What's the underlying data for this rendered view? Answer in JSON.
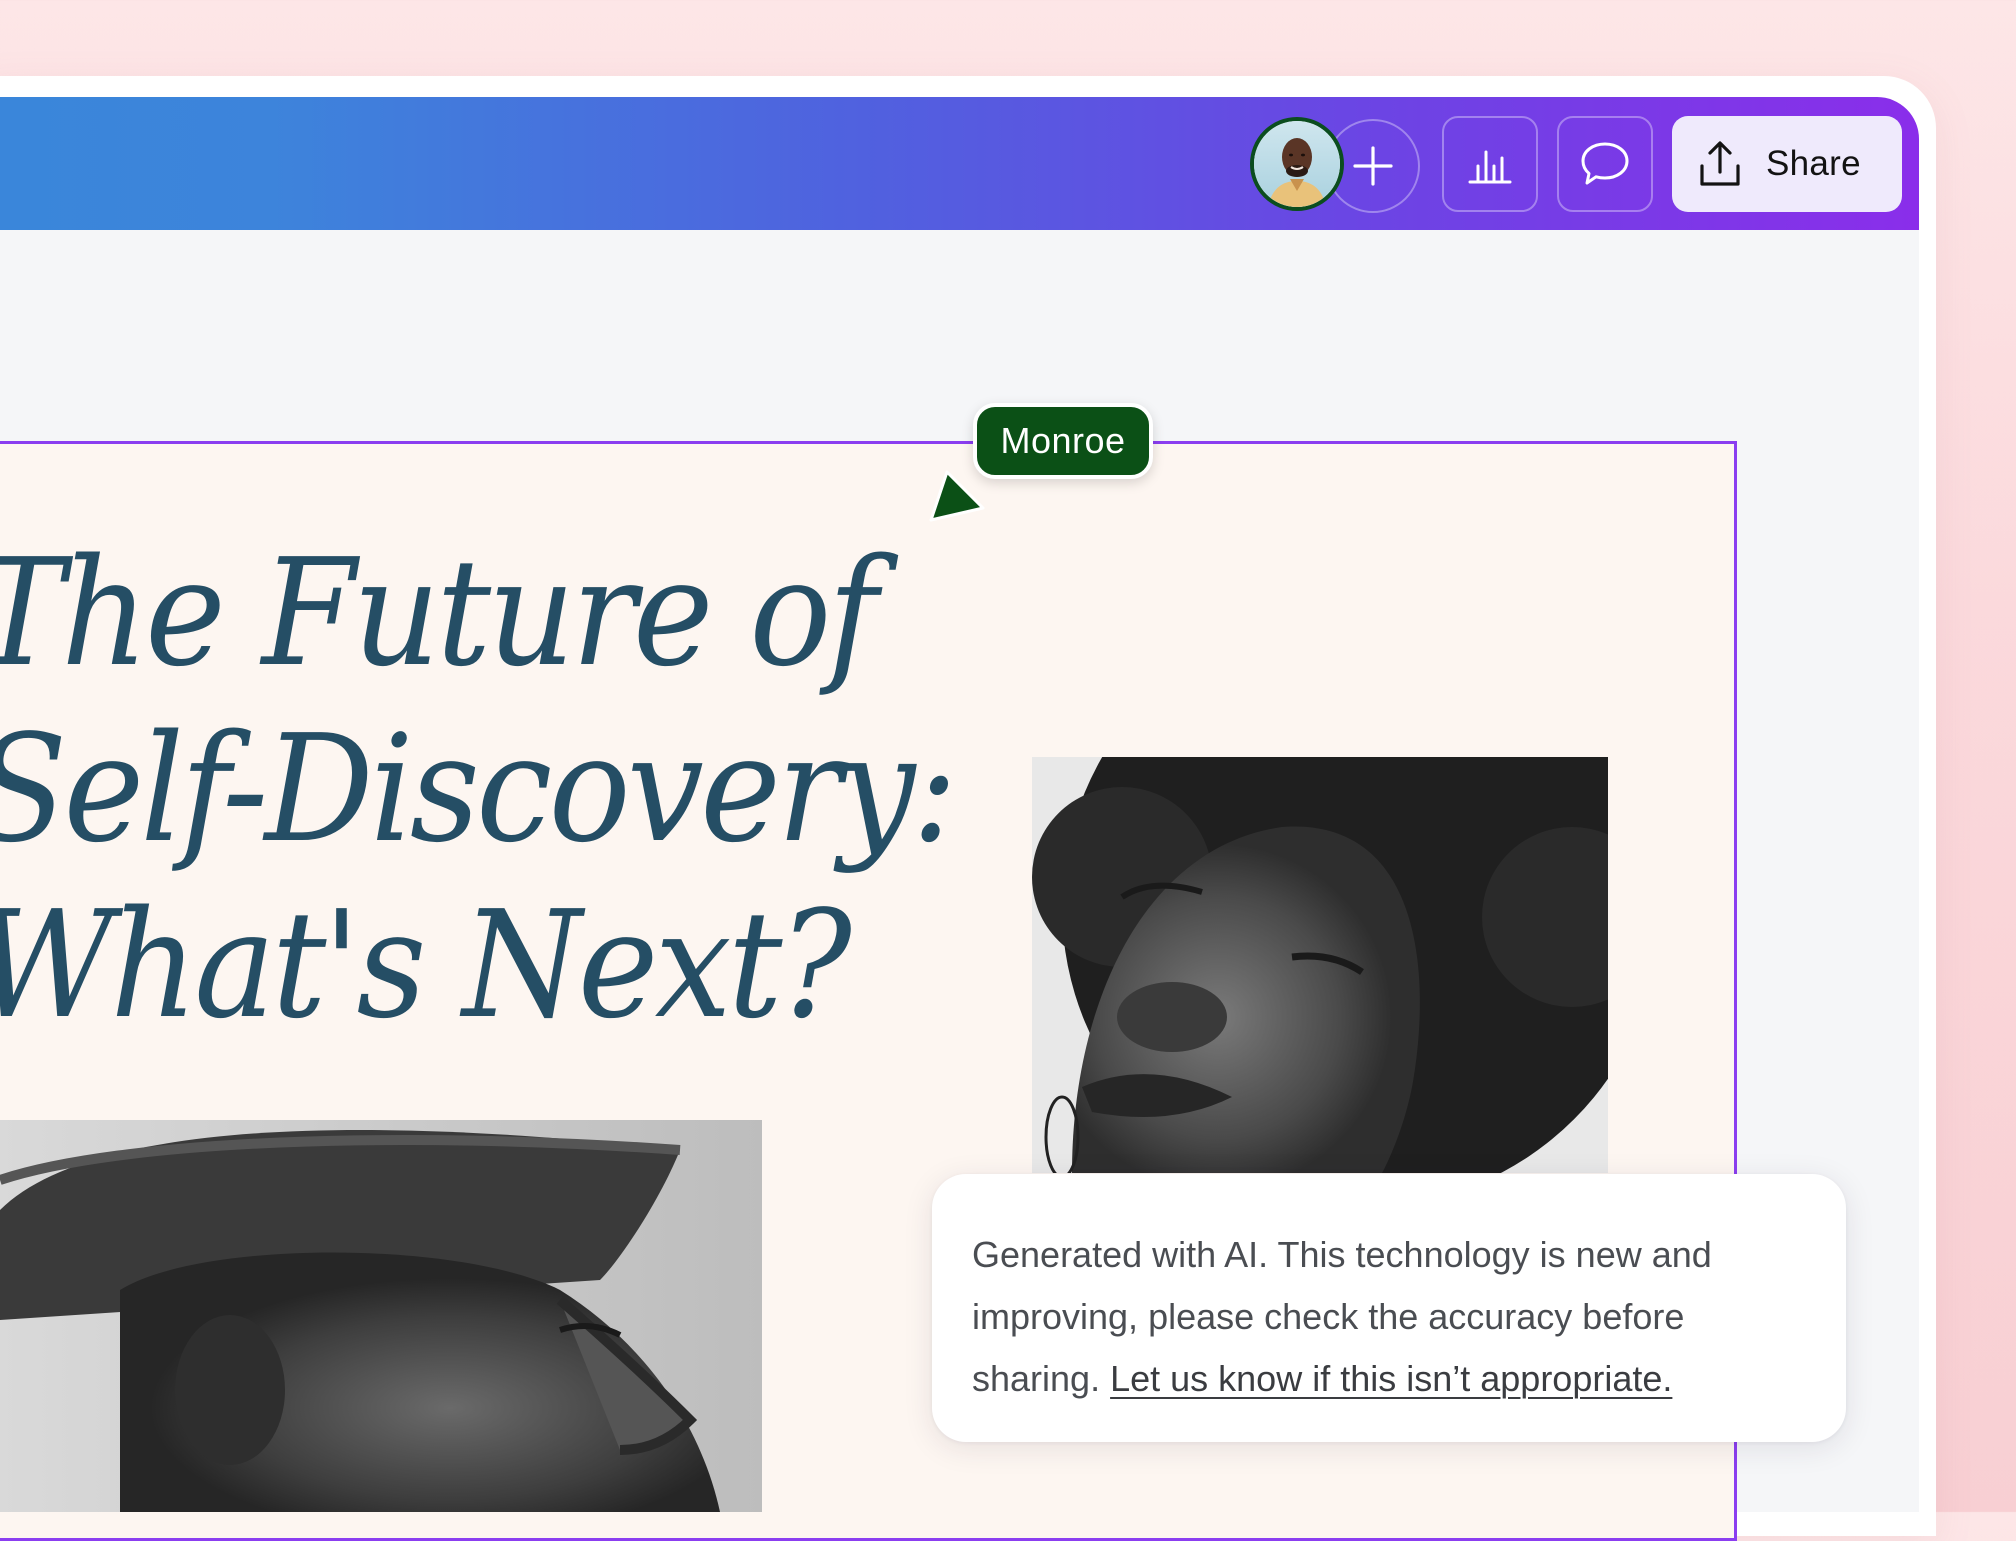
{
  "toolbar": {
    "share_label": "Share",
    "add_collaborator_icon": "plus-icon",
    "insights_icon": "bar-chart-icon",
    "comments_icon": "speech-bubble-icon",
    "share_icon": "upload-icon"
  },
  "collaborator": {
    "name": "Monroe",
    "color": "#0b5016"
  },
  "design": {
    "headline_lines": [
      "The Future of",
      "Self-Discovery:",
      "What's Next?"
    ],
    "headline_color": "#254e65",
    "selection_color": "#8b3ef0"
  },
  "ai_notice": {
    "text": "Generated with AI. This technology is new and improving, please check the accuracy before sharing.",
    "link": "Let us know if this isn’t appropriate."
  },
  "colors": {
    "topbar_start": "#3a86da",
    "topbar_end": "#8a2eea",
    "share_bg": "#efeafc"
  }
}
